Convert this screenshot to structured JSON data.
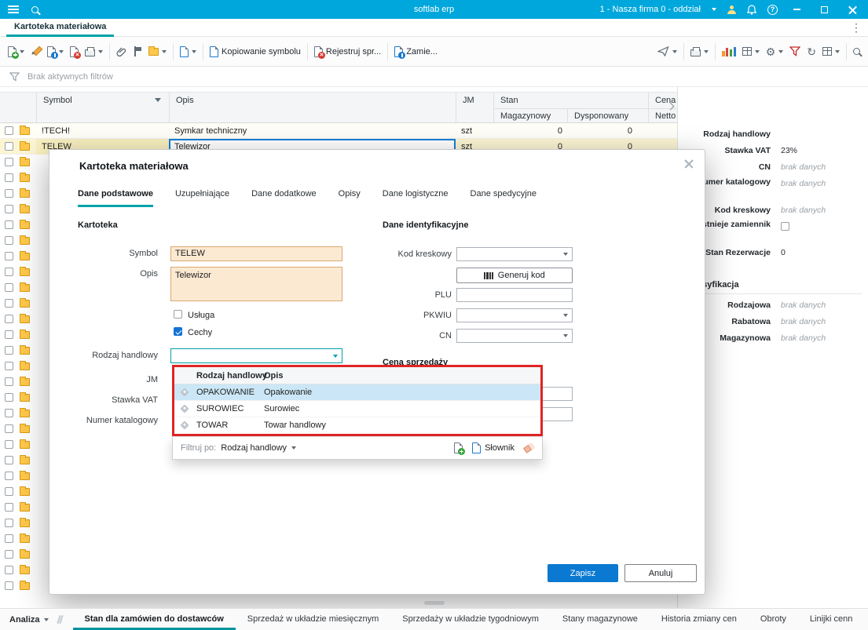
{
  "icons": {
    "gear": "⚙",
    "refresh": "↻",
    "help": "?",
    "more_vert": "⋮"
  },
  "titlebar": {
    "app_title": "softlab erp",
    "company_selector": "1 - Nasza firma 0 - oddział"
  },
  "document_tab": "Kartoteka materiałowa",
  "toolbar": {
    "copy_symbol_label": "Kopiowanie symbolu",
    "register_label": "Rejestruj spr...",
    "zamien_label": "Zamie..."
  },
  "filter_bar": {
    "status": "Brak aktywnych filtrów"
  },
  "table": {
    "ghost_rows": 28,
    "columns": {
      "symbol": "Symbol",
      "opis": "Opis",
      "jm": "JM",
      "stan": "Stan",
      "cena": "Cena",
      "magazynowy": "Magazynowy",
      "dysponowany": "Dysponowany",
      "netto": "Netto"
    },
    "rows": [
      {
        "symbol": "!TECH!",
        "opis": "Symkar techniczny",
        "jm": "szt",
        "magazynowy": "0",
        "dysponowany": "0"
      },
      {
        "symbol": "TELEW",
        "opis": "Telewizor",
        "jm": "szt",
        "magazynowy": "0",
        "dysponowany": "0"
      }
    ]
  },
  "side_panel": {
    "rodzaj_handlowy_label": "Rodzaj handlowy",
    "stawka_vat_label": "Stawka VAT",
    "stawka_vat_value": "23%",
    "cn_label": "CN",
    "cn_value": "brak danych",
    "numer_katalogowy_label": "Numer katalogowy",
    "numer_katalogowy_value": "brak danych",
    "kod_kreskowy_label": "Kod kreskowy",
    "kod_kreskowy_value": "brak danych",
    "istnieje_zamiennik_label": "Istnieje zamiennik",
    "stan_rezerwacje_label": "Stan Rezerwacje",
    "stan_rezerwacje_value": "0",
    "klasyfikacja_header": "Klasyfikacja",
    "rodzajowa_label": "Rodzajowa",
    "rodzajowa_value": "brak danych",
    "rabatowa_label": "Rabatowa",
    "rabatowa_value": "brak danych",
    "magazynowa_label": "Magazynowa",
    "magazynowa_value": "brak danych"
  },
  "dialog": {
    "title": "Kartoteka materiałowa",
    "tabs": [
      "Dane podstawowe",
      "Uzupełniające",
      "Dane dodatkowe",
      "Opisy",
      "Dane logistyczne",
      "Dane spedycyjne"
    ],
    "section_kartoteka": "Kartoteka",
    "symbol_label": "Symbol",
    "symbol_value": "TELEW",
    "opis_label": "Opis",
    "opis_value": "Telewizor",
    "usluga_label": "Usługa",
    "cechy_label": "Cechy",
    "rodzaj_handlowy_label": "Rodzaj handlowy",
    "jm_label": "JM",
    "stawka_vat_label": "Stawka VAT",
    "numer_katalogowy_label": "Numer katalogowy",
    "section_identyfikacyjne": "Dane identyfikacyjne",
    "kod_kreskowy_label": "Kod kreskowy",
    "generuj_kod_label": "Generuj kod",
    "plu_label": "PLU",
    "pkwiu_label": "PKWIU",
    "cn_label": "CN",
    "section_cena": "Cena sprzedaży",
    "dropdown": {
      "col_rodzaj": "Rodzaj handlowy",
      "col_opis": "Opis",
      "rows": [
        {
          "value": "OPAKOWANIE",
          "opis": "Opakowanie"
        },
        {
          "value": "SUROWIEC",
          "opis": "Surowiec"
        },
        {
          "value": "TOWAR",
          "opis": "Towar handlowy"
        }
      ],
      "filter_label": "Filtruj po:",
      "filter_field": "Rodzaj handlowy",
      "slownik_label": "Słownik"
    },
    "save_label": "Zapisz",
    "cancel_label": "Anuluj"
  },
  "bottom_bar": {
    "analiza_label": "Analiza",
    "tabs": [
      "Stan dla zamówien do dostawców",
      "Sprzedaż w układzie miesięcznym",
      "Sprzedaży w układzie tygodniowym",
      "Stany magazynowe",
      "Historia zmiany cen",
      "Obroty",
      "Linijki cenn"
    ]
  },
  "colors": {
    "accent_teal": "#00A3A9",
    "titlebar_blue": "#00A7DC",
    "primary_blue": "#0B79D1",
    "highlight_red": "#E02424",
    "selected_yellow": "#FBF5D3"
  }
}
